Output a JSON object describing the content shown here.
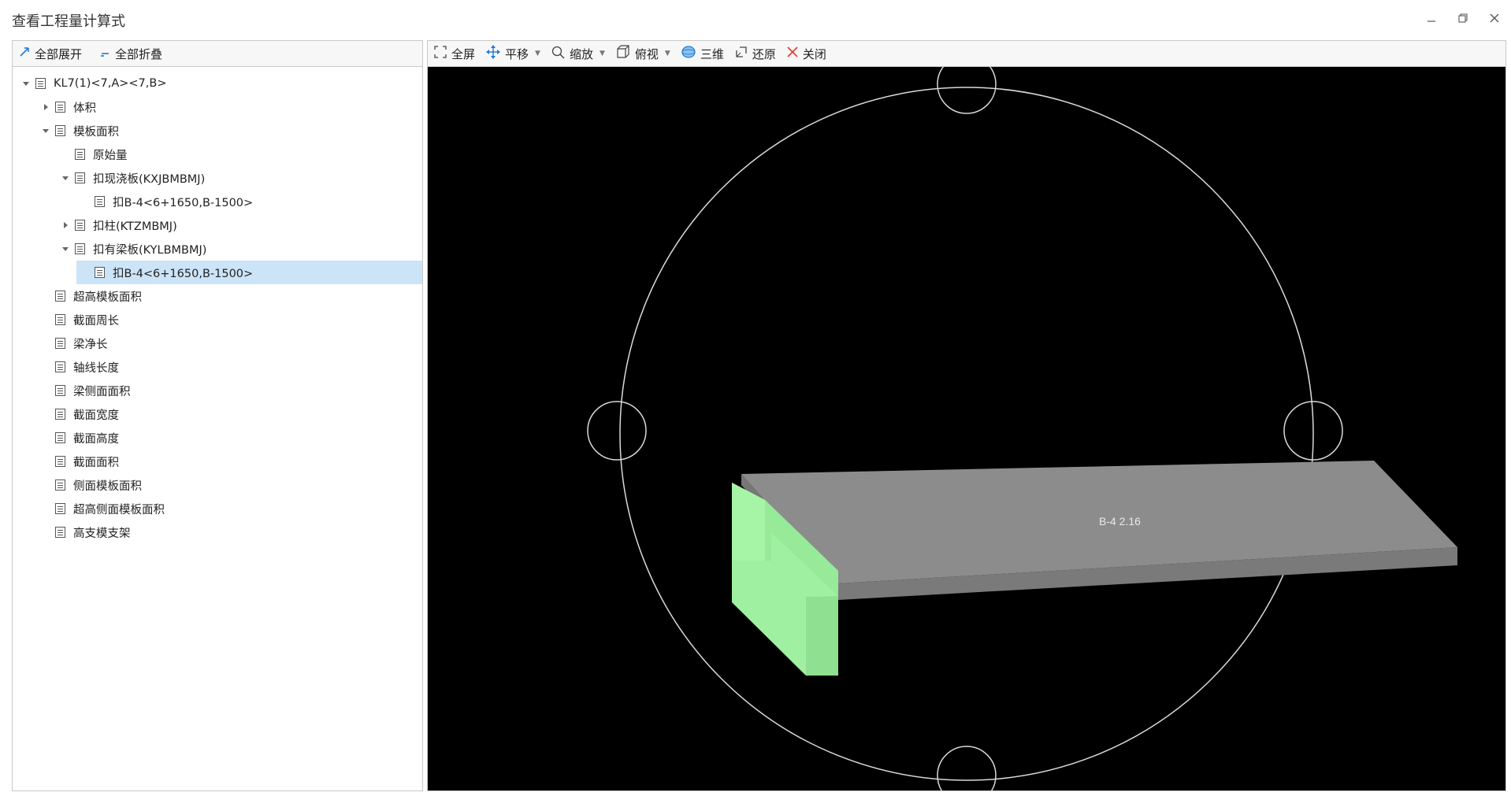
{
  "window": {
    "title": "查看工程量计算式"
  },
  "left_toolbar": {
    "expand_all": "全部展开",
    "collapse_all": "全部折叠"
  },
  "tree": [
    {
      "label": "KL7(1)<7,A><7,B>",
      "toggle": "expanded"
    },
    {
      "label": "体积",
      "toggle": "collapsed"
    },
    {
      "label": "模板面积",
      "toggle": "expanded"
    },
    {
      "label": "原始量",
      "toggle": "none"
    },
    {
      "label": "扣现浇板(KXJBMBMJ)",
      "toggle": "expanded"
    },
    {
      "label": "扣B-4<6+1650,B-1500>",
      "toggle": "none"
    },
    {
      "label": "扣柱(KTZMBMJ)",
      "toggle": "collapsed"
    },
    {
      "label": "扣有梁板(KYLBMBMJ)",
      "toggle": "expanded"
    },
    {
      "label": "扣B-4<6+1650,B-1500>",
      "toggle": "none",
      "selected": true
    },
    {
      "label": "超高模板面积",
      "toggle": "none"
    },
    {
      "label": "截面周长",
      "toggle": "none"
    },
    {
      "label": "梁净长",
      "toggle": "none"
    },
    {
      "label": "轴线长度",
      "toggle": "none"
    },
    {
      "label": "梁侧面面积",
      "toggle": "none"
    },
    {
      "label": "截面宽度",
      "toggle": "none"
    },
    {
      "label": "截面高度",
      "toggle": "none"
    },
    {
      "label": "截面面积",
      "toggle": "none"
    },
    {
      "label": "侧面模板面积",
      "toggle": "none"
    },
    {
      "label": "超高侧面模板面积",
      "toggle": "none"
    },
    {
      "label": "高支模支架",
      "toggle": "none"
    }
  ],
  "view_toolbar": {
    "fullscreen": "全屏",
    "pan": "平移",
    "zoom": "缩放",
    "top_view": "俯视",
    "three_d": "三维",
    "restore": "还原",
    "close": "关闭"
  },
  "scene": {
    "slab_label": "B-4 2.16",
    "background_color": "#000000",
    "slab_color": "#8c8c8c",
    "beam_color": "#a6f5a6",
    "orbit_color": "#d9d9d9"
  },
  "colors": {
    "selected_row": "#cce4f7",
    "accent": "#1e7ad6",
    "close_red": "#e53935"
  }
}
